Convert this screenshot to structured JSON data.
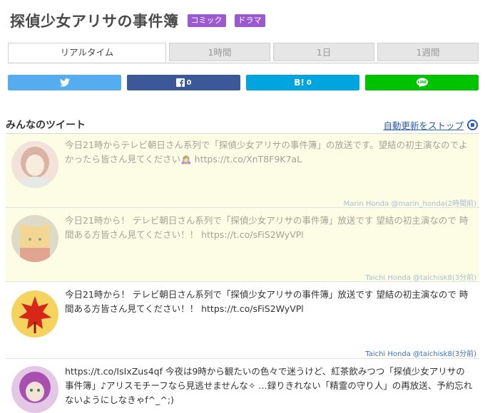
{
  "header": {
    "title": "探偵少女アリサの事件簿",
    "badges": [
      "コミック",
      "ドラマ"
    ]
  },
  "tabs": [
    "リアルタイム",
    "1時間",
    "1日",
    "1週間"
  ],
  "share": {
    "twitter": {
      "count": "",
      "color": "#55acee"
    },
    "facebook": {
      "count": "0",
      "color": "#3b5998"
    },
    "hatena": {
      "count": "0",
      "color": "#00a4de"
    },
    "line": {
      "count": "",
      "color": "#00c300"
    }
  },
  "section": {
    "title": "みんなのツイート",
    "auto_update_link": "自動更新をストップ"
  },
  "tweets": [
    {
      "text": "今日21時からテレビ朝日さん系列で「探偵少女アリサの事件簿」の放送です。望結の初主演なのでよかったら皆さん見てください🙇‍♀️ https://t.co/XnT8F9K7aL",
      "meta": "Marin Honda @marin_honda(2時間前)"
    },
    {
      "text": "今日21時から！ テレビ朝日さん系列で「探偵少女アリサの事件簿」放送です 望結の初主演なので 時間ある方皆さん見てください！！ https://t.co/sFiS2WyVPl",
      "meta": "Taichi Honda @taichisk8(3分前)"
    },
    {
      "text": "今日21時から！ テレビ朝日さん系列で「探偵少女アリサの事件簿」放送です 望結の初主演なので 時間ある方皆さん見てください！！ https://t.co/sFiS2WyVPl",
      "meta": "Taichi Honda @taichisk8(3分前)"
    },
    {
      "text": "https://t.co/IsIxZus4qf 今夜は9時から観たいの色々で迷うけど、紅茶飲みつつ「探偵少女アリサの事件簿」♪アリスモチーフなら見逃せませんな✧ …録りきれない「精霊の守り人」の再放送、予約忘れないようにしなきゃf^_^;)",
      "meta": ""
    }
  ]
}
